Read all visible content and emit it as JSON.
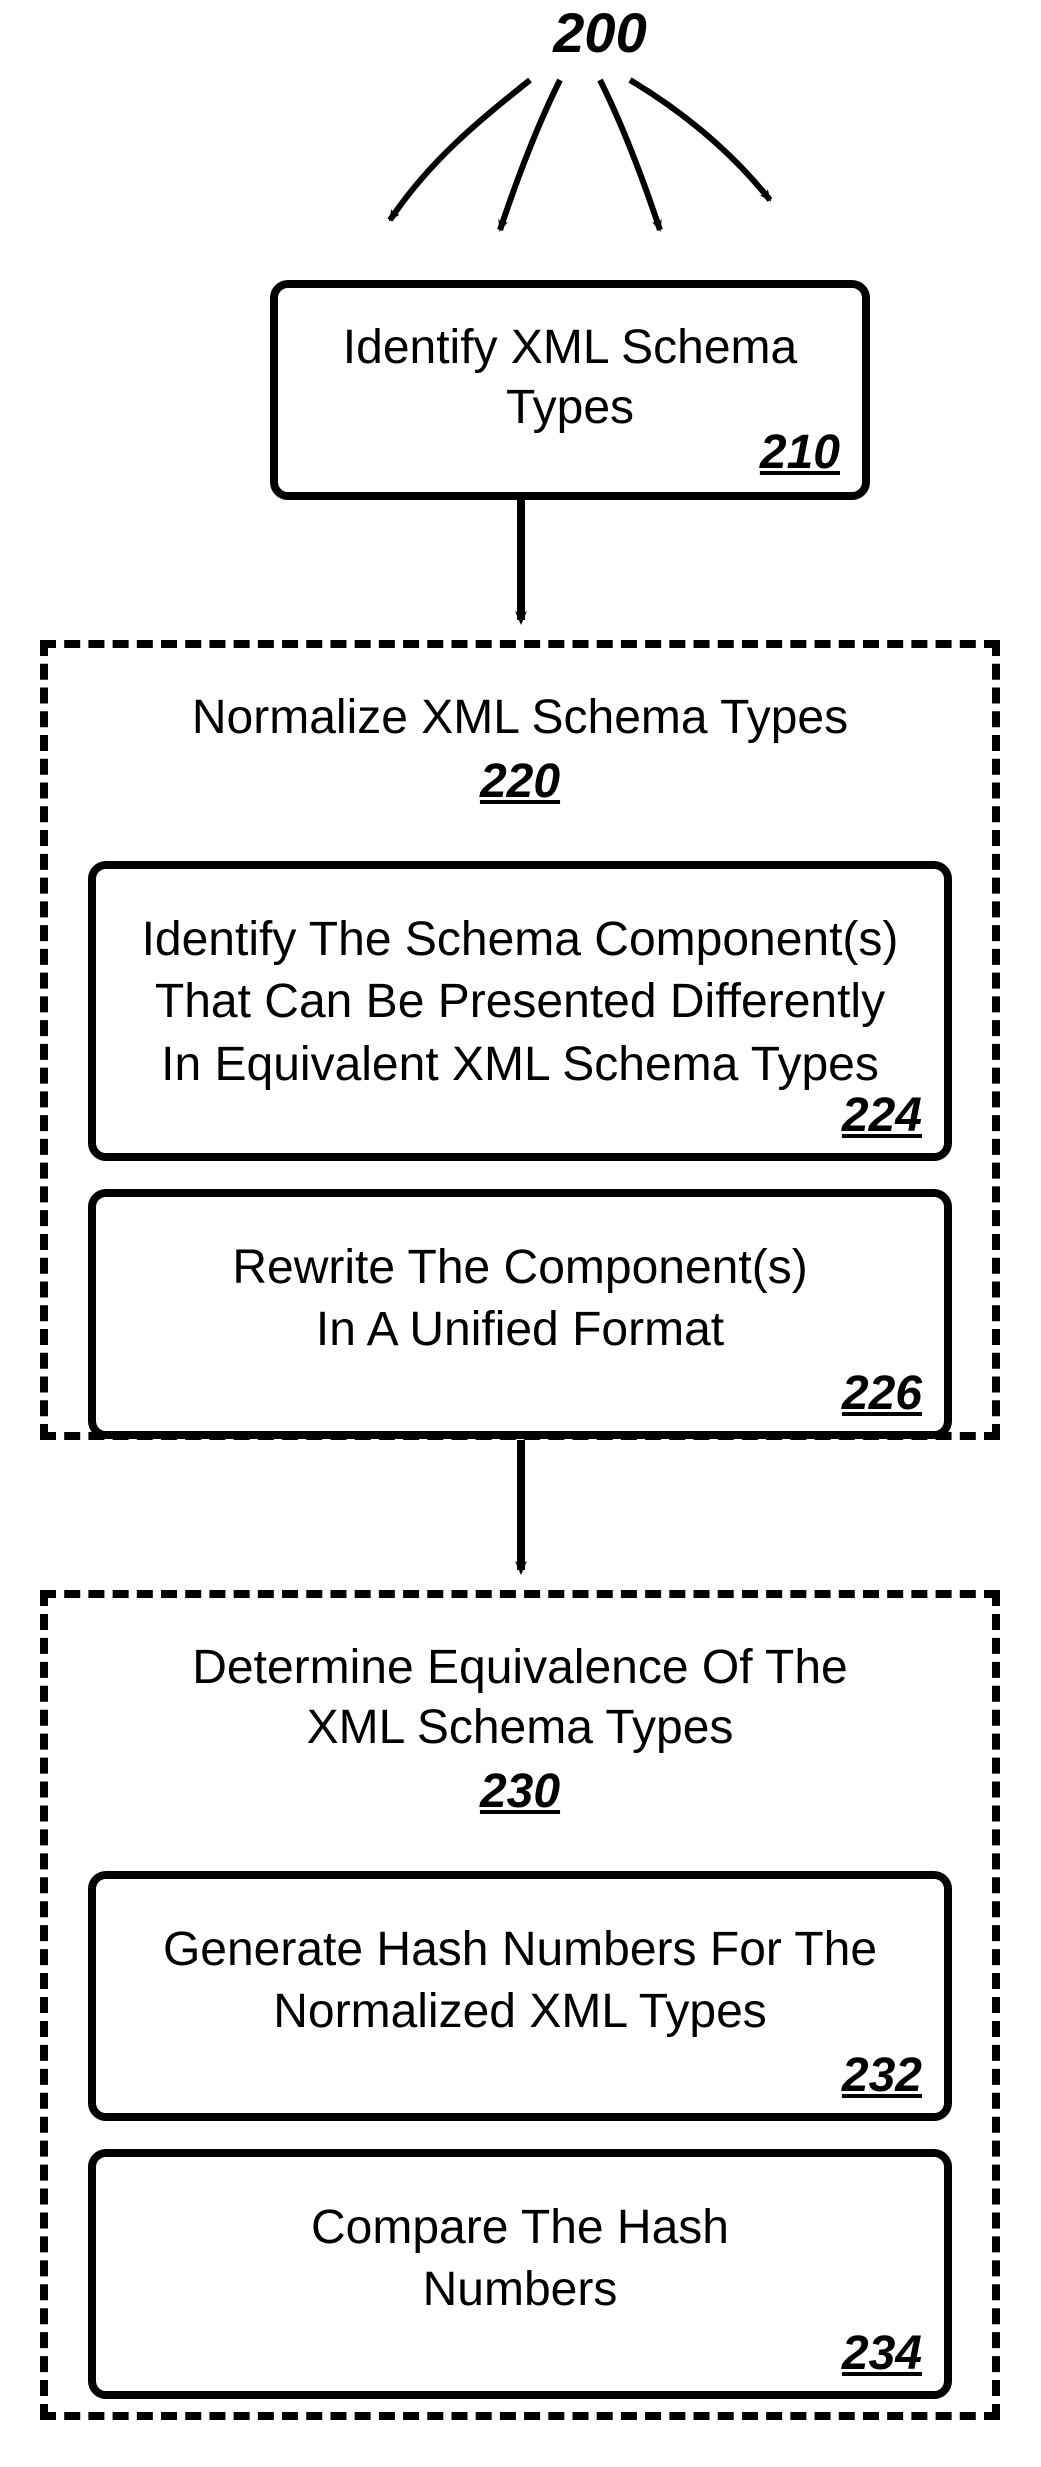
{
  "figure": {
    "overall_ref": "200",
    "step1": {
      "title": "Identify XML Schema\nTypes",
      "ref": "210"
    },
    "group_normalize": {
      "title": "Normalize XML Schema Types",
      "ref": "220",
      "sub_identify": {
        "text": "Identify The Schema Component(s)\nThat Can Be Presented Differently\nIn Equivalent XML Schema Types",
        "ref": "224"
      },
      "sub_rewrite": {
        "text": "Rewrite The Component(s)\nIn A Unified Format",
        "ref": "226"
      }
    },
    "group_determine": {
      "title": "Determine Equivalence Of The\nXML Schema Types",
      "ref": "230",
      "sub_hash": {
        "text": "Generate Hash Numbers For The\nNormalized XML Types",
        "ref": "232"
      },
      "sub_compare": {
        "text": "Compare The Hash\nNumbers",
        "ref": "234"
      }
    }
  }
}
